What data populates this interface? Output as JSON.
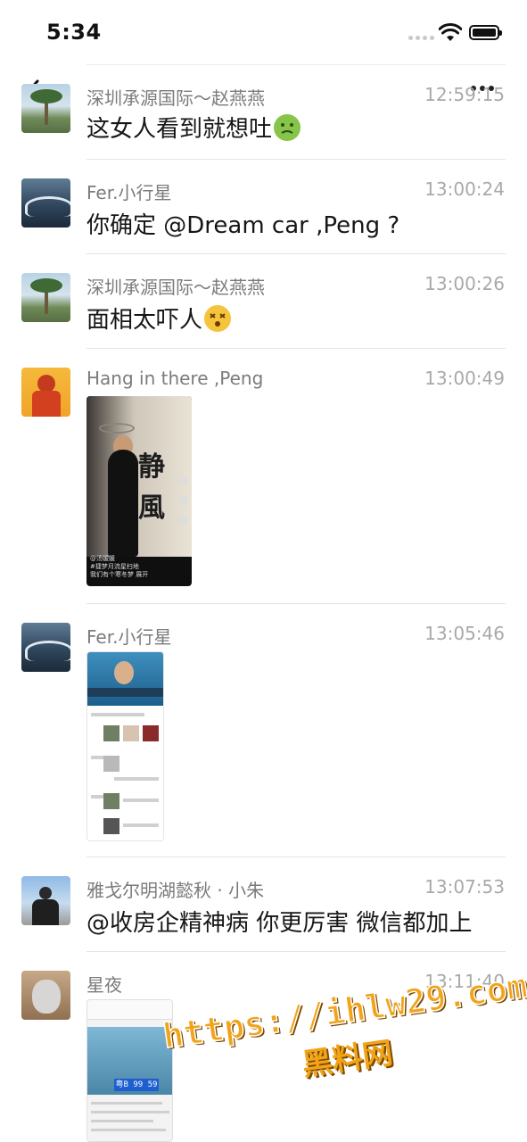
{
  "status_bar": {
    "time": "5:34"
  },
  "comments": [
    {
      "name": "深圳承源国际～赵燕燕",
      "time": "12:59:15",
      "text": "这女人看到就想吐",
      "emoji": "nauseated-face"
    },
    {
      "name": "Fer.小行星",
      "time": "13:00:24",
      "text": "你确定 @Dream car ,Peng ?"
    },
    {
      "name": "深圳承源国际～赵燕燕",
      "time": "13:00:26",
      "text": "面相太吓人",
      "emoji": "dizzy-face"
    },
    {
      "name": "Hang in there ,Peng",
      "time": "13:00:49",
      "image": "video-thumbnail",
      "thumb_chars": [
        "静",
        "風"
      ],
      "thumb_caption_1": "@汤媛媛",
      "thumb_caption_2": "#捷梦月流星扫地",
      "thumb_caption_3": "我们有个寒冬梦 展开"
    },
    {
      "name": "Fer.小行星",
      "time": "13:05:46",
      "image": "profile-screenshot"
    },
    {
      "name": "雅戈尔明湖懿秋 · 小朱",
      "time": "13:07:53",
      "text": "@收房企精神病 你更厉害 微信都加上"
    },
    {
      "name": "星夜",
      "time": "13:11:40",
      "image": "car-plate-screenshot",
      "plate_text": "粤B 99 59"
    }
  ],
  "watermark": {
    "url": "https://ihlw29.com",
    "name": "黑料网"
  }
}
